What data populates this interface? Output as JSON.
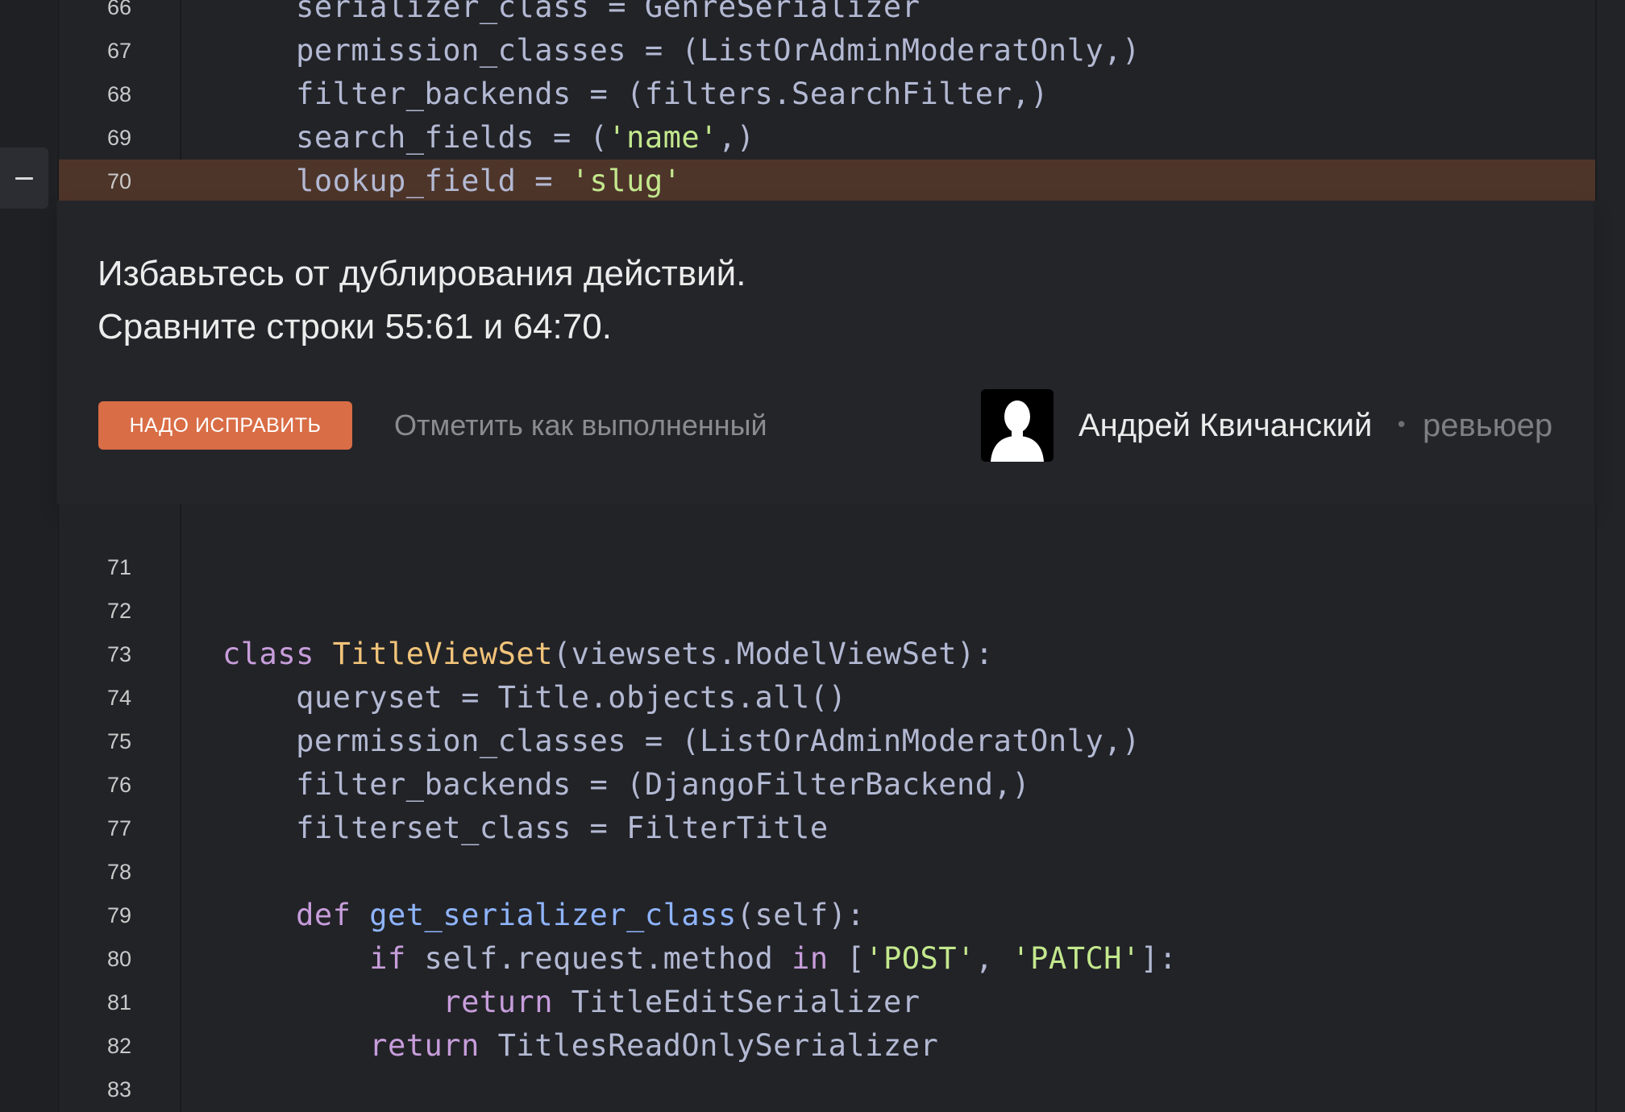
{
  "top_code": [
    {
      "num": "66",
      "tokens": [
        [
          "plain",
          "    serializer_class = GenreSerializer"
        ]
      ]
    },
    {
      "num": "67",
      "tokens": [
        [
          "plain",
          "    permission_classes = (ListOrAdminModeratOnly,)"
        ]
      ]
    },
    {
      "num": "68",
      "tokens": [
        [
          "plain",
          "    filter_backends = (filters.SearchFilter,)"
        ]
      ]
    },
    {
      "num": "69",
      "tokens": [
        [
          "plain",
          "    search_fields = ("
        ],
        [
          "str",
          "'name'"
        ],
        [
          "plain",
          ",)"
        ]
      ]
    },
    {
      "num": "70",
      "highlight": true,
      "tokens": [
        [
          "plain",
          "    lookup_field = "
        ],
        [
          "str",
          "'slug'"
        ]
      ]
    }
  ],
  "comment": {
    "collapse_icon": "minus-icon",
    "lines": [
      "Избавьтесь от дублирования действий.",
      "Сравните строки 55:61 и 64:70."
    ],
    "fix_button_label": "НАДО ИСПРАВИТЬ",
    "mark_done_label": "Отметить как выполненный",
    "reviewer_name": "Андрей Квичанский",
    "separator": "•",
    "reviewer_role": "ревьюер",
    "fix_button_color": "#d96d46",
    "highlight_color": "#4e352a"
  },
  "bottom_code": [
    {
      "num": "71",
      "tokens": []
    },
    {
      "num": "72",
      "tokens": []
    },
    {
      "num": "73",
      "tokens": [
        [
          "kw",
          "class "
        ],
        [
          "cls",
          "TitleViewSet"
        ],
        [
          "plain",
          "(viewsets.ModelViewSet):"
        ]
      ]
    },
    {
      "num": "74",
      "tokens": [
        [
          "plain",
          "    queryset = Title.objects.all()"
        ]
      ]
    },
    {
      "num": "75",
      "tokens": [
        [
          "plain",
          "    permission_classes = (ListOrAdminModeratOnly,)"
        ]
      ]
    },
    {
      "num": "76",
      "tokens": [
        [
          "plain",
          "    filter_backends = (DjangoFilterBackend,)"
        ]
      ]
    },
    {
      "num": "77",
      "tokens": [
        [
          "plain",
          "    filterset_class = FilterTitle"
        ]
      ]
    },
    {
      "num": "78",
      "tokens": []
    },
    {
      "num": "79",
      "tokens": [
        [
          "kw",
          "    def "
        ],
        [
          "fn",
          "get_serializer_class"
        ],
        [
          "plain",
          "(self):"
        ]
      ]
    },
    {
      "num": "80",
      "tokens": [
        [
          "kw",
          "        if "
        ],
        [
          "plain",
          "self.request.method "
        ],
        [
          "kw",
          "in "
        ],
        [
          "plain",
          "["
        ],
        [
          "str",
          "'POST'"
        ],
        [
          "plain",
          ", "
        ],
        [
          "str",
          "'PATCH'"
        ],
        [
          "plain",
          "]:"
        ]
      ]
    },
    {
      "num": "81",
      "tokens": [
        [
          "kw",
          "            return "
        ],
        [
          "plain",
          "TitleEditSerializer"
        ]
      ]
    },
    {
      "num": "82",
      "tokens": [
        [
          "kw",
          "        return "
        ],
        [
          "plain",
          "TitlesReadOnlySerializer"
        ]
      ]
    },
    {
      "num": "83",
      "tokens": []
    }
  ]
}
